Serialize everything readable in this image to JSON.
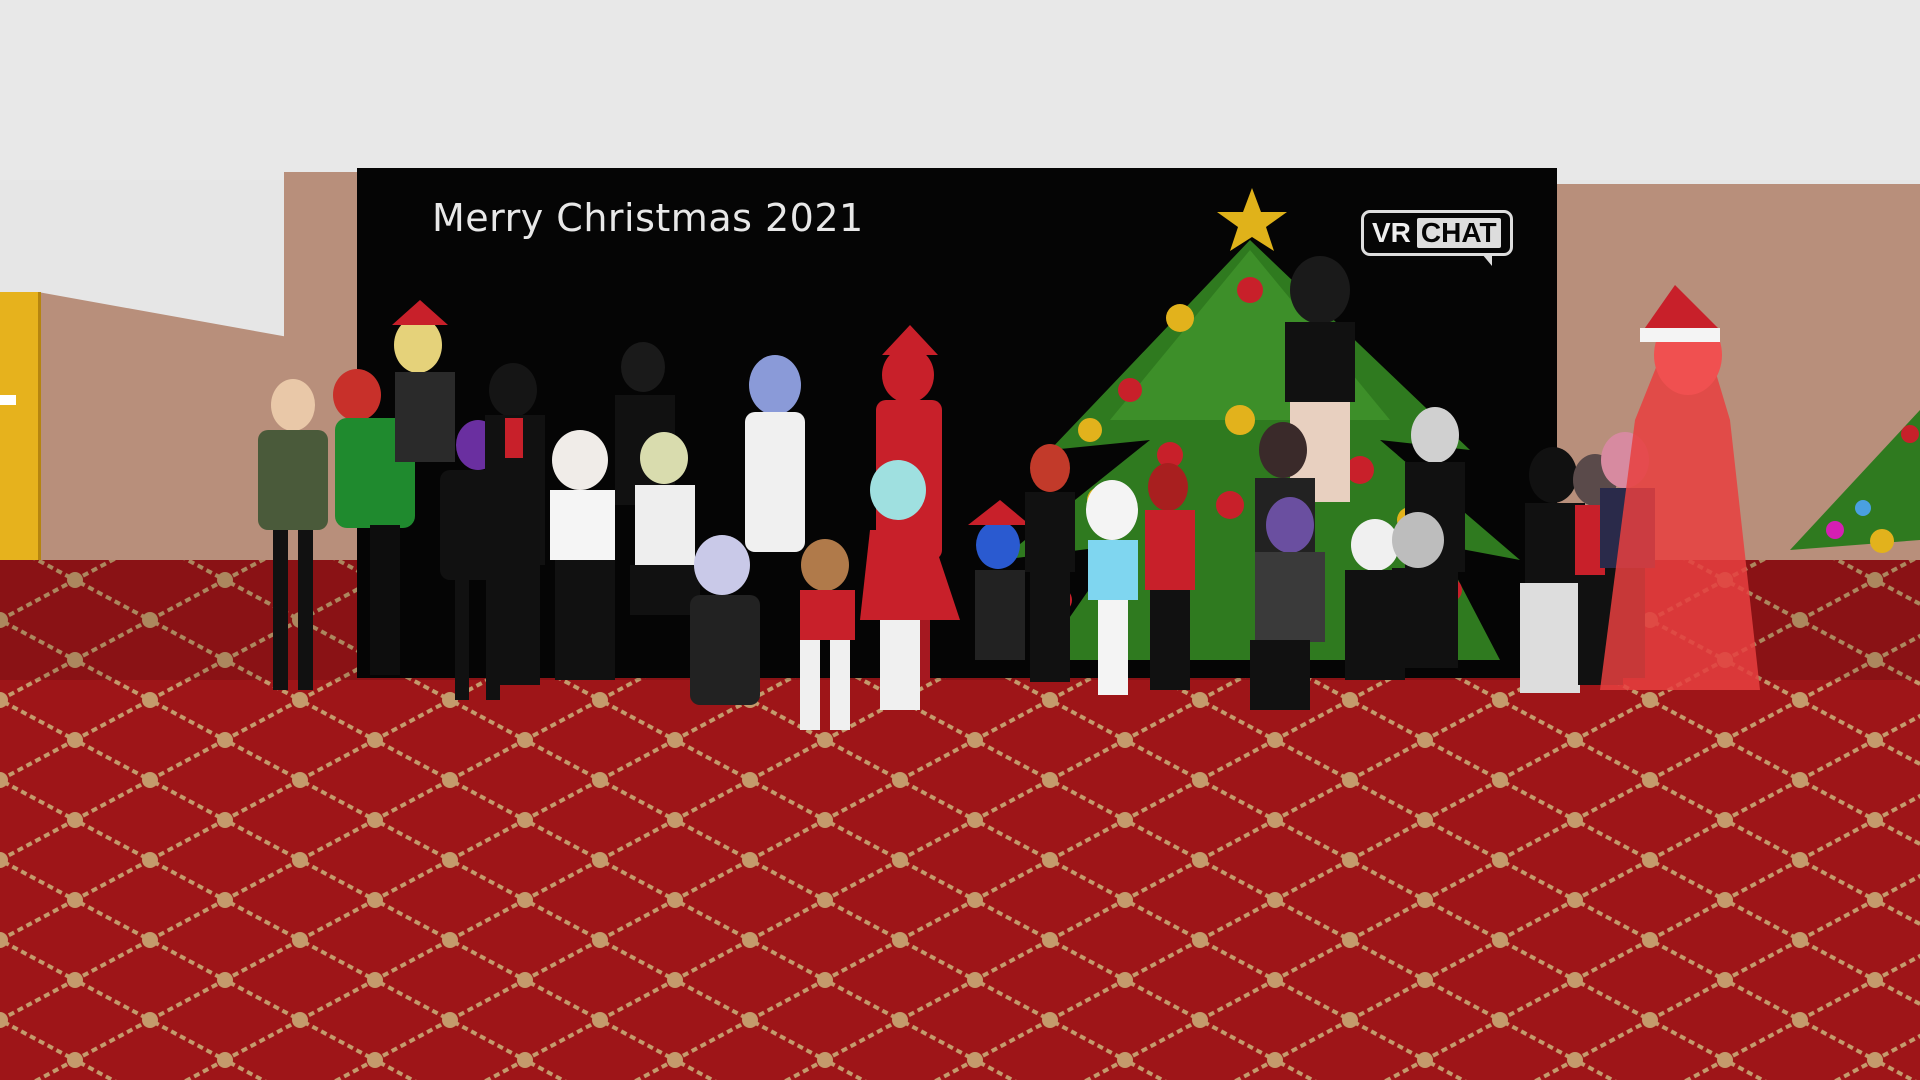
{
  "board": {
    "title": "Merry Christmas 2021",
    "logo_vr": "VR",
    "logo_chat": "CHAT"
  },
  "colors": {
    "board": "#050505",
    "wall": "#b88f7b",
    "carpet": "#9e1518",
    "carpet_pattern": "#c49a6c",
    "door": "#e6b21d",
    "tree": "#2f7a1f",
    "star": "#e0b21a"
  },
  "icons": [
    "star-icon",
    "christmas-tree",
    "vrchat-logo"
  ]
}
